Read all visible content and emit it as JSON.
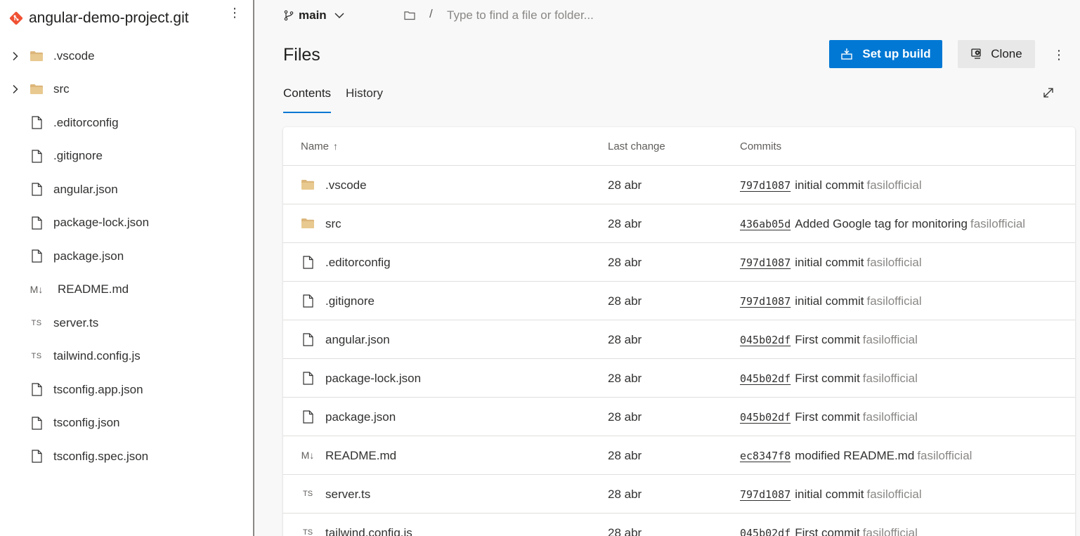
{
  "sidebar": {
    "repo_name": "angular-demo-project.git",
    "more": "⋮",
    "items": [
      {
        "label": ".vscode",
        "type": "folder",
        "icon": "folder-icon",
        "badge": ""
      },
      {
        "label": "src",
        "type": "folder",
        "icon": "folder-icon",
        "badge": ""
      },
      {
        "label": ".editorconfig",
        "type": "file",
        "icon": "file-icon",
        "badge": ""
      },
      {
        "label": ".gitignore",
        "type": "file",
        "icon": "file-icon",
        "badge": ""
      },
      {
        "label": "angular.json",
        "type": "file",
        "icon": "file-icon",
        "badge": ""
      },
      {
        "label": "package-lock.json",
        "type": "file",
        "icon": "file-icon",
        "badge": ""
      },
      {
        "label": "package.json",
        "type": "file",
        "icon": "file-icon",
        "badge": ""
      },
      {
        "label": "README.md",
        "type": "md",
        "icon": "markdown-icon",
        "badge": "M↓"
      },
      {
        "label": "server.ts",
        "type": "ts",
        "icon": "typescript-icon",
        "badge": "TS"
      },
      {
        "label": "tailwind.config.js",
        "type": "ts",
        "icon": "typescript-icon",
        "badge": "TS"
      },
      {
        "label": "tsconfig.app.json",
        "type": "file",
        "icon": "file-icon",
        "badge": ""
      },
      {
        "label": "tsconfig.json",
        "type": "file",
        "icon": "file-icon",
        "badge": ""
      },
      {
        "label": "tsconfig.spec.json",
        "type": "file",
        "icon": "file-icon",
        "badge": ""
      }
    ]
  },
  "topbar": {
    "branch": "main",
    "path_separator": "/",
    "path_placeholder": "Type to find a file or folder..."
  },
  "header": {
    "title": "Files",
    "setup_build_label": "Set up build",
    "clone_label": "Clone",
    "more": "⋮",
    "tabs": [
      {
        "label": "Contents",
        "active": true
      },
      {
        "label": "History",
        "active": false
      }
    ]
  },
  "table": {
    "columns": {
      "name": "Name",
      "sort_indicator": "↑",
      "last_change": "Last change",
      "commits": "Commits"
    },
    "rows": [
      {
        "name": ".vscode",
        "type": "folder",
        "badge": "",
        "date": "28 abr",
        "hash": "797d1087",
        "message": "initial commit",
        "author": "fasilofficial"
      },
      {
        "name": "src",
        "type": "folder",
        "badge": "",
        "date": "28 abr",
        "hash": "436ab05d",
        "message": "Added Google tag for monitoring",
        "author": "fasilofficial"
      },
      {
        "name": ".editorconfig",
        "type": "file",
        "badge": "",
        "date": "28 abr",
        "hash": "797d1087",
        "message": "initial commit",
        "author": "fasilofficial"
      },
      {
        "name": ".gitignore",
        "type": "file",
        "badge": "",
        "date": "28 abr",
        "hash": "797d1087",
        "message": "initial commit",
        "author": "fasilofficial"
      },
      {
        "name": "angular.json",
        "type": "file",
        "badge": "",
        "date": "28 abr",
        "hash": "045b02df",
        "message": "First commit",
        "author": "fasilofficial"
      },
      {
        "name": "package-lock.json",
        "type": "file",
        "badge": "",
        "date": "28 abr",
        "hash": "045b02df",
        "message": "First commit",
        "author": "fasilofficial"
      },
      {
        "name": "package.json",
        "type": "file",
        "badge": "",
        "date": "28 abr",
        "hash": "045b02df",
        "message": "First commit",
        "author": "fasilofficial"
      },
      {
        "name": "README.md",
        "type": "md",
        "badge": "M↓",
        "date": "28 abr",
        "hash": "ec8347f8",
        "message": "modified README.md",
        "author": "fasilofficial"
      },
      {
        "name": "server.ts",
        "type": "ts",
        "badge": "TS",
        "date": "28 abr",
        "hash": "797d1087",
        "message": "initial commit",
        "author": "fasilofficial"
      },
      {
        "name": "tailwind.config.js",
        "type": "ts",
        "badge": "TS",
        "date": "28 abr",
        "hash": "045b02df",
        "message": "First commit",
        "author": "fasilofficial"
      }
    ]
  },
  "colors": {
    "accent": "#0078d4",
    "git_logo": "#f05133",
    "folder": "#dcb67a",
    "text": "#323130",
    "muted": "#8a8886"
  }
}
